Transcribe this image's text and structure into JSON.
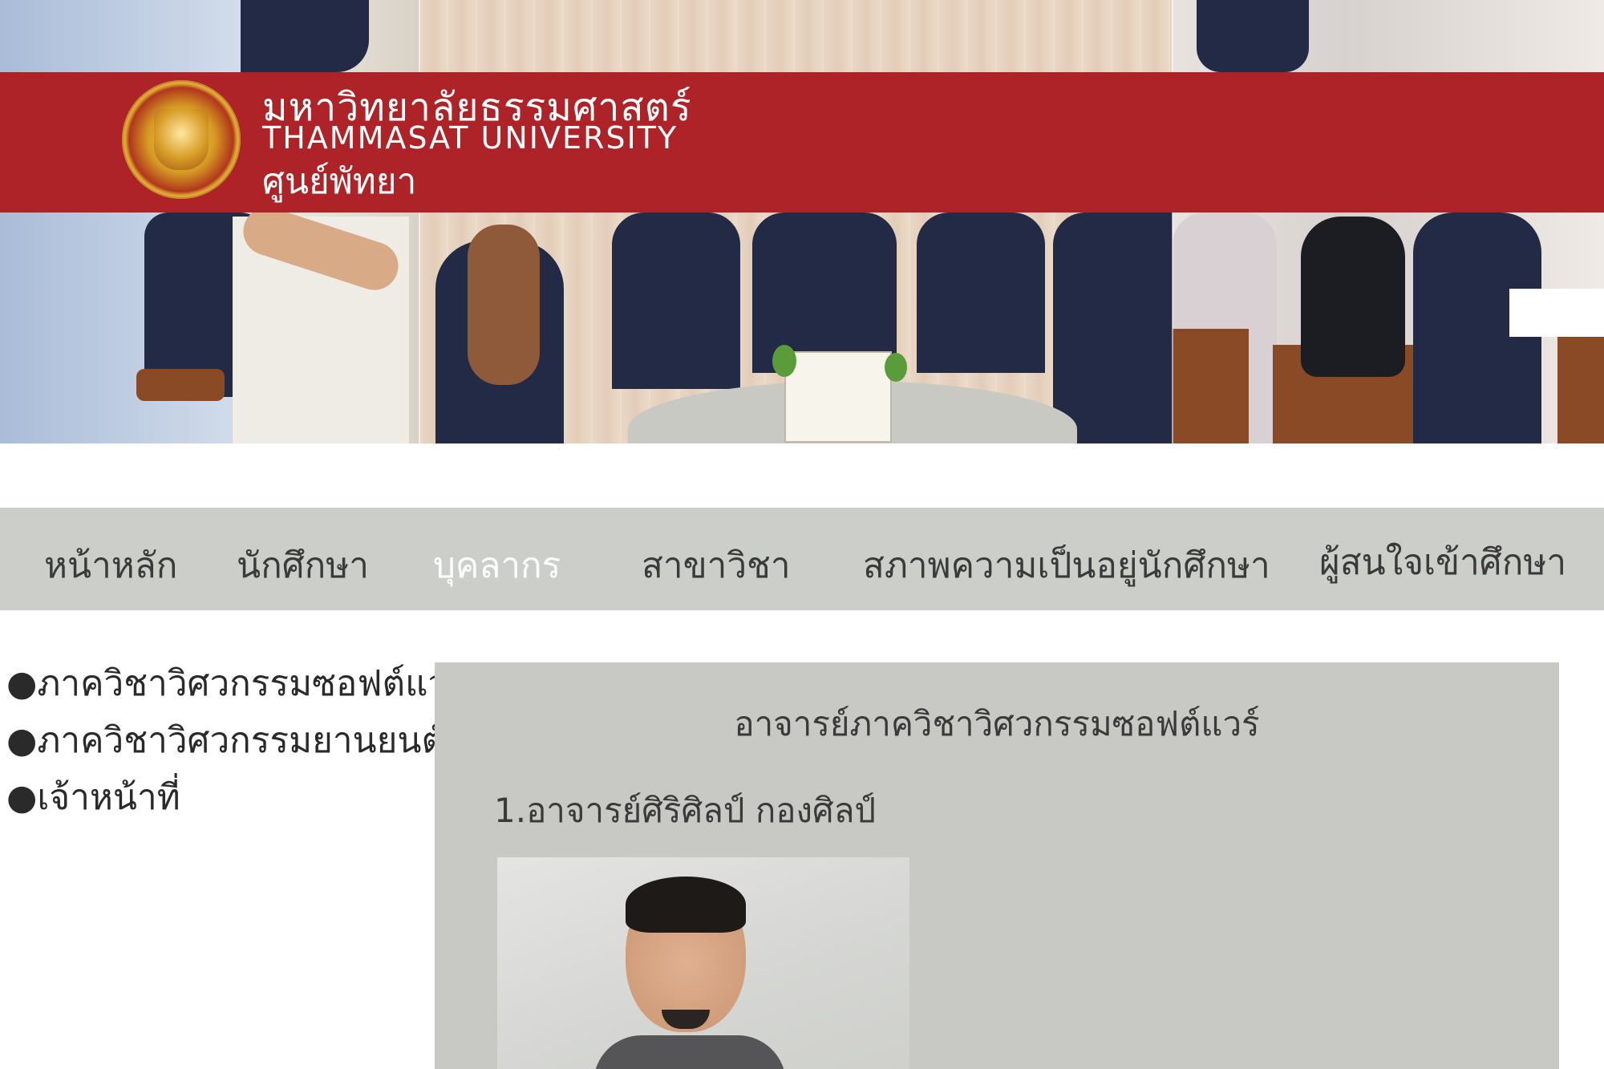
{
  "header": {
    "university_name_th": "มหาวิทยาลัยธรรมศาสตร์",
    "university_name_en": "THAMMASAT UNIVERSITY",
    "campus": "ศูนย์พัทยา",
    "seal_icon": "thammasat-seal-icon",
    "brand_color": "#ad2327"
  },
  "nav": {
    "items": [
      {
        "label": "หน้าหลัก"
      },
      {
        "label": "นักศึกษา"
      },
      {
        "label": "บุคลากร",
        "active": true
      },
      {
        "label": "สาขาวิชา"
      },
      {
        "label": "สภาพความเป็นอยู่นักศึกษา"
      },
      {
        "label": "ผู้สนใจเข้าศึกษา"
      }
    ],
    "background_color": "#ccceca",
    "active_color": "#ffffff"
  },
  "sidebar": {
    "items": [
      {
        "label": "●ภาควิชาวิศวกรรมซอฟต์แวร์"
      },
      {
        "label": "●ภาควิชาวิศวกรรมยานยนต์"
      },
      {
        "label": "●เจ้าหน้าที่"
      }
    ]
  },
  "content": {
    "title": "อาจารย์ภาควิชาวิศวกรรมซอฟต์แวร์",
    "person_name": "1.อาจารย์ศิริศิลป์   กองศิลป์",
    "panel_color": "#c8c9c5"
  }
}
